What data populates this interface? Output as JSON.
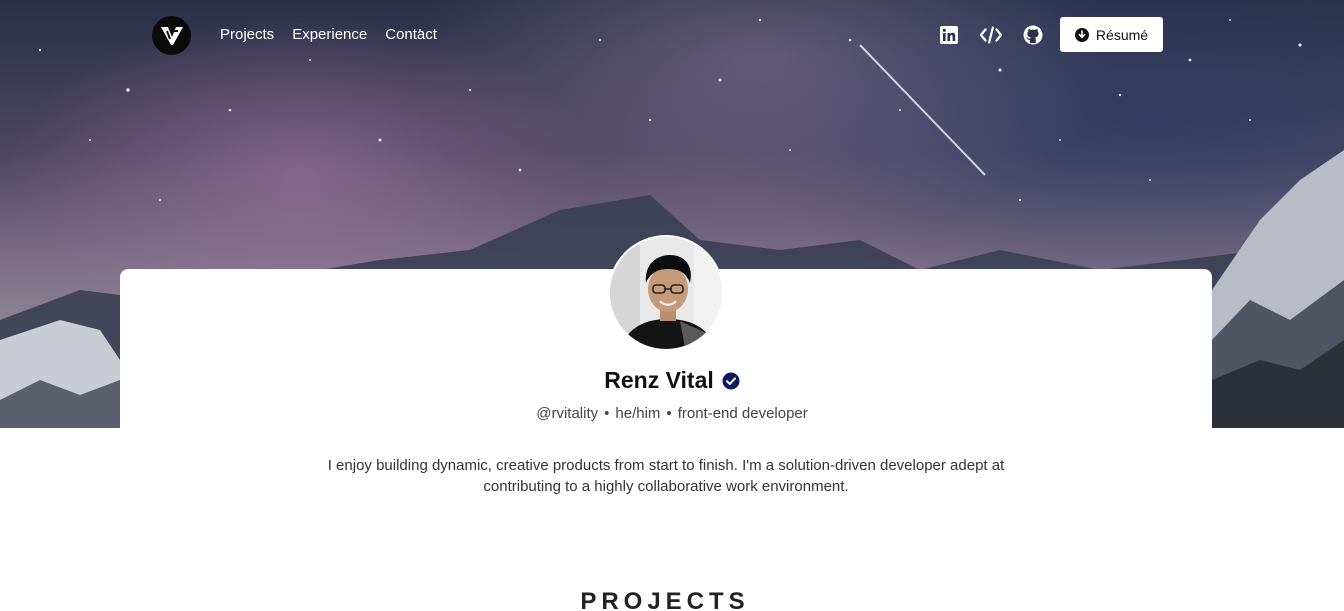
{
  "nav": {
    "links": [
      "Projects",
      "Experience",
      "Contact"
    ],
    "icons": [
      "linkedin-icon",
      "code-icon",
      "github-icon"
    ],
    "resume_label": "Résumé"
  },
  "profile": {
    "name": "Renz Vital",
    "handle": "@rvitality",
    "pronouns": "he/him",
    "role": "front-end developer",
    "separator": "•",
    "bio": "I enjoy building dynamic, creative products from start to finish. I'm a solution-driven developer adept at contributing to a highly collaborative work environment."
  },
  "sections": {
    "projects_title": "PROJECTS"
  },
  "colors": {
    "verified_badge": "#0d1b5e",
    "button_bg": "#ffffff",
    "nav_text": "#ffffff"
  }
}
